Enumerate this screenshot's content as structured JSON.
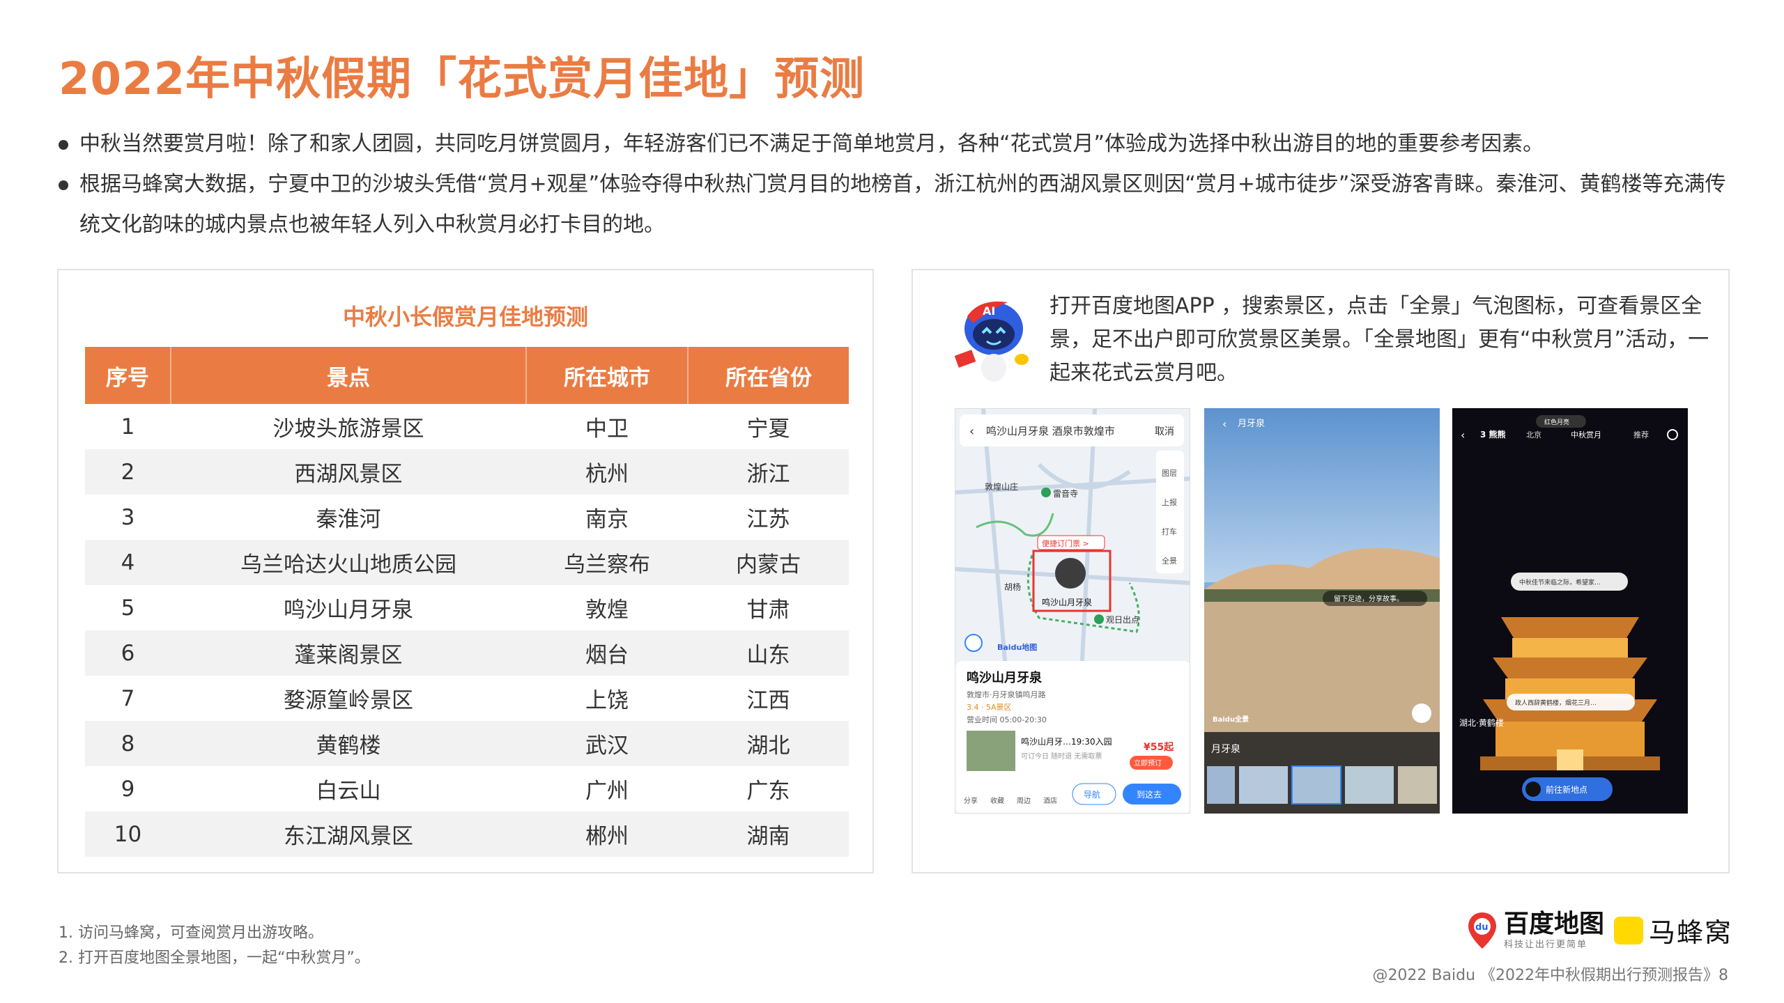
{
  "title": "2022年中秋假期「花式赏月佳地」预测",
  "bullets": [
    "中秋当然要赏月啦！除了和家人团圆，共同吃月饼赏圆月，年轻游客们已不满足于简单地赏月，各种“花式赏月”体验成为选择中秋出游目的地的重要参考因素。",
    "根据马蜂窝大数据，宁夏中卫的沙坡头凭借“赏月+观星”体验夺得中秋热门赏月目的地榜首，浙江杭州的西湖风景区则因“赏月+城市徒步”深受游客青睐。秦淮河、黄鹤楼等充满传统文化韵味的城内景点也被年轻人列入中秋赏月必打卡目的地。"
  ],
  "table": {
    "title": "中秋小长假赏月佳地预测",
    "headers": [
      "序号",
      "景点",
      "所在城市",
      "所在省份"
    ],
    "rows": [
      [
        "1",
        "沙坡头旅游景区",
        "中卫",
        "宁夏"
      ],
      [
        "2",
        "西湖风景区",
        "杭州",
        "浙江"
      ],
      [
        "3",
        "秦淮河",
        "南京",
        "江苏"
      ],
      [
        "4",
        "乌兰哈达火山地质公园",
        "乌兰察布",
        "内蒙古"
      ],
      [
        "5",
        "鸣沙山月牙泉",
        "敦煌",
        "甘肃"
      ],
      [
        "6",
        "蓬莱阁景区",
        "烟台",
        "山东"
      ],
      [
        "7",
        "婺源篁岭景区",
        "上饶",
        "江西"
      ],
      [
        "8",
        "黄鹤楼",
        "武汉",
        "湖北"
      ],
      [
        "9",
        "白云山",
        "广州",
        "广东"
      ],
      [
        "10",
        "东江湖风景区",
        "郴州",
        "湖南"
      ]
    ]
  },
  "right_panel": {
    "description": "打开百度地图APP ，搜索景区，点击「全景」气泡图标，可查看景区全景，足不出户即可欣赏景区美景。「全景地图」更有“中秋赏月”活动，一起来花式云赏月吧。",
    "phone1": {
      "search_text": "鸣沙山月牙泉 酒泉市敦煌市",
      "cancel": "取消",
      "poi_1": "敦煌山庄",
      "poi_2": "雷音寺",
      "poi_3": "便捷订门票 >",
      "poi_4": "鸣沙山月牙泉",
      "poi_5": "观日出点",
      "poi_6": "胡杨",
      "side_1": "图层",
      "side_2": "上报",
      "side_3": "打车",
      "side_4": "全景",
      "card_title": "鸣沙山月牙泉",
      "card_addr": "敦煌市·月牙泉镇鸣月路",
      "card_rating": "3.4 · 5A景区",
      "card_hours": "营业时间 05:00-20:30",
      "ticket_name": "鸣沙山月牙…19:30入园",
      "ticket_note": "可订今日 随时退 无需取票",
      "price": "¥55起",
      "book": "立即预订",
      "nav_share": "分享",
      "nav_fav": "收藏",
      "nav_near": "周边",
      "nav_hotel": "酒店",
      "nav_btn": "导航",
      "go_btn": "到这去",
      "baidu": "Baidu地图"
    },
    "phone2": {
      "header": "月牙泉",
      "bubble": "留下足迹，分享故事。",
      "strip_title": "月牙泉",
      "baidu": "Baidu全景"
    },
    "phone3": {
      "logo": "3 熊熊",
      "tab_1": "北京",
      "tab_2": "中秋赏月",
      "tab_3": "推荐",
      "top_bubble": "红色月亮",
      "bubble_1": "中秋佳节来临之际，希望家…",
      "bubble_2": "政人西辞黄鹤楼，烟花三月…",
      "location": "湖北·黄鹤楼",
      "button": "前往新地点"
    }
  },
  "footnotes": [
    "1.   访问马蜂窝，可查阅赏月出游攻略。",
    "2.   打开百度地图全景地图，一起“中秋赏月”。"
  ],
  "logos": {
    "baidu_name": "百度地图",
    "baidu_slogan": "科技让出行更简单",
    "mafengwo_name": "马蜂窝"
  },
  "credit": "@2022 Baidu 《2022年中秋假期出行预测报告》8",
  "colors": {
    "accent": "#ea7c43",
    "row_alt": "#f2f2f2",
    "mafengwo_yellow": "#ffd900",
    "baidu_red": "#e8352f",
    "baidu_blue": "#3385ff"
  }
}
